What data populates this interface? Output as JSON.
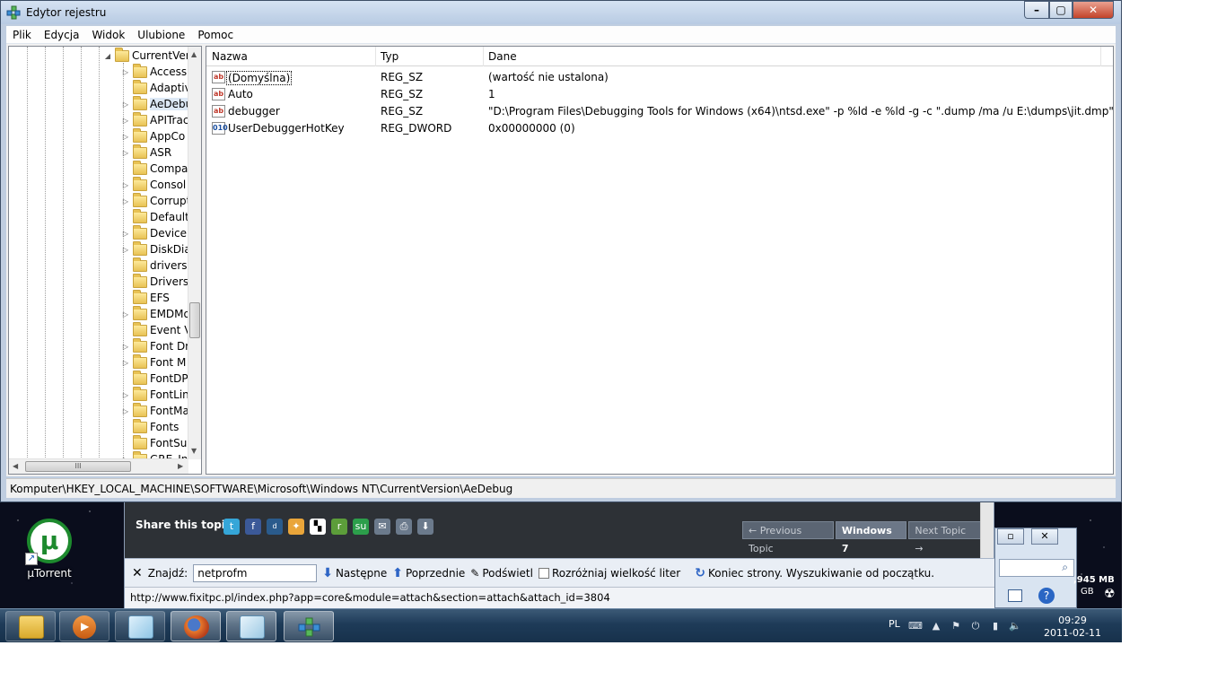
{
  "window": {
    "title": "Edytor rejestru"
  },
  "menu": [
    "Plik",
    "Edycja",
    "Widok",
    "Ulubione",
    "Pomoc"
  ],
  "tree": {
    "root_item": "CurrentVer",
    "items": [
      "Accessi",
      "Adaptiv",
      "AeDebu",
      "APITrac",
      "AppCo",
      "ASR",
      "Compa",
      "Consol",
      "Corrupt",
      "Default",
      "Device",
      "DiskDia",
      "drivers.",
      "Drivers3",
      "EFS",
      "EMDMo",
      "Event V",
      "Font Dr",
      "Font M",
      "FontDP",
      "FontLin",
      "FontMa",
      "Fonts",
      "FontSu",
      "GRE_Ini"
    ],
    "hscroll_grip": "III"
  },
  "columns": {
    "name": "Nazwa",
    "type": "Typ",
    "data": "Dane"
  },
  "values": [
    {
      "icon": "string-value-icon",
      "glyph": "ab",
      "name": "(Domyślna)",
      "type": "REG_SZ",
      "data": "(wartość nie ustalona)"
    },
    {
      "icon": "string-value-icon",
      "glyph": "ab",
      "name": "Auto",
      "type": "REG_SZ",
      "data": "1"
    },
    {
      "icon": "string-value-icon",
      "glyph": "ab",
      "name": "debugger",
      "type": "REG_SZ",
      "data": "\"D:\\Program Files\\Debugging Tools for Windows (x64)\\ntsd.exe\" -p %ld -e %ld -g -c \".dump /ma /u E:\\dumps\\jit.dmp\""
    },
    {
      "icon": "dword-value-icon",
      "glyph": "010",
      "name": "UserDebuggerHotKey",
      "type": "REG_DWORD",
      "data": "0x00000000 (0)"
    }
  ],
  "statusbar": {
    "path": "Komputer\\HKEY_LOCAL_MACHINE\\SOFTWARE\\Microsoft\\Windows NT\\CurrentVersion\\AeDebug"
  },
  "desktop": {
    "utorrent_label": "µTorrent"
  },
  "firefox": {
    "share_label": "Share this topic:",
    "prev_topic": "← Previous Topic",
    "current_topic": "Windows 7",
    "next_topic": "Next Topic →",
    "find_label": "Znajdź:",
    "find_value": "netprofm",
    "next_label": "Następne",
    "prev_label": "Poprzednie",
    "highlight_label": "Podświetl",
    "match_case_label": "Rozróżniaj wielkość liter",
    "find_status": "Koniec strony. Wyszukiwanie od początku.",
    "status_url": "http://www.fixitpc.pl/index.php?app=core&module=attach&section=attach&attach_id=3804"
  },
  "right_window": {
    "mem_text": ",945 MB",
    "disk_text": "GB"
  },
  "tray": {
    "lang": "PL",
    "time": "09:29",
    "date": "2011-02-11"
  },
  "colors": {
    "taskbar": "#1e3b58",
    "selection": "#dde9f6",
    "close_button": "#c3432a"
  }
}
